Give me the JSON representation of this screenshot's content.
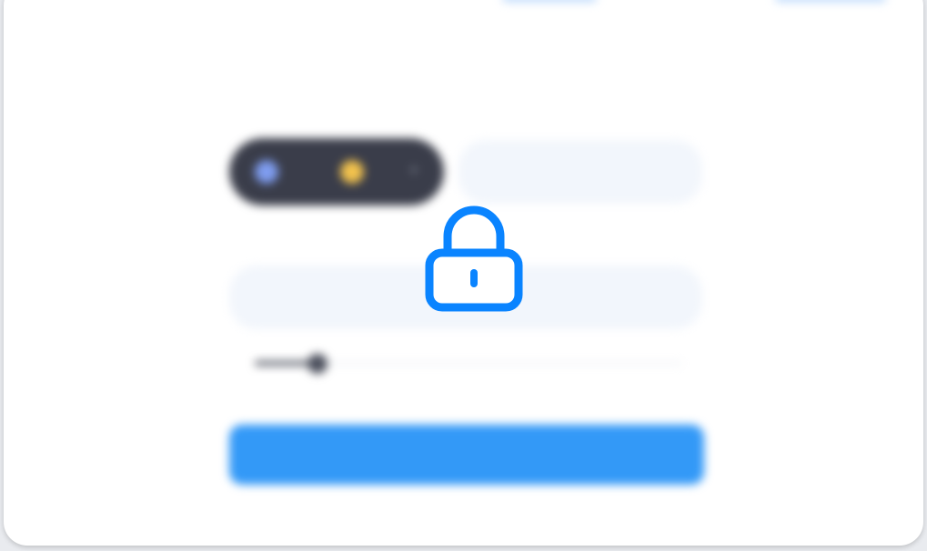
{
  "colors": {
    "accent": "#3399f7",
    "lock": "#0a84ff",
    "dark_pill": "#3a3d4a",
    "field_bg": "#f2f6fc"
  },
  "form": {
    "title": "",
    "pair_label": "",
    "pair": {
      "base_icon": "eth-coin-icon",
      "base_symbol": "",
      "quote_icon": "usdc-coin-icon",
      "quote_symbol": ""
    },
    "amount": {
      "value": "",
      "suffix": ""
    },
    "days_label": "",
    "days": {
      "value": "",
      "suffix": ""
    },
    "slider": {
      "min_label": "",
      "max_label": "",
      "level_fraction": 0.14
    },
    "submit_label": ""
  },
  "overlay": {
    "icon": "lock-icon",
    "state": "locked"
  }
}
